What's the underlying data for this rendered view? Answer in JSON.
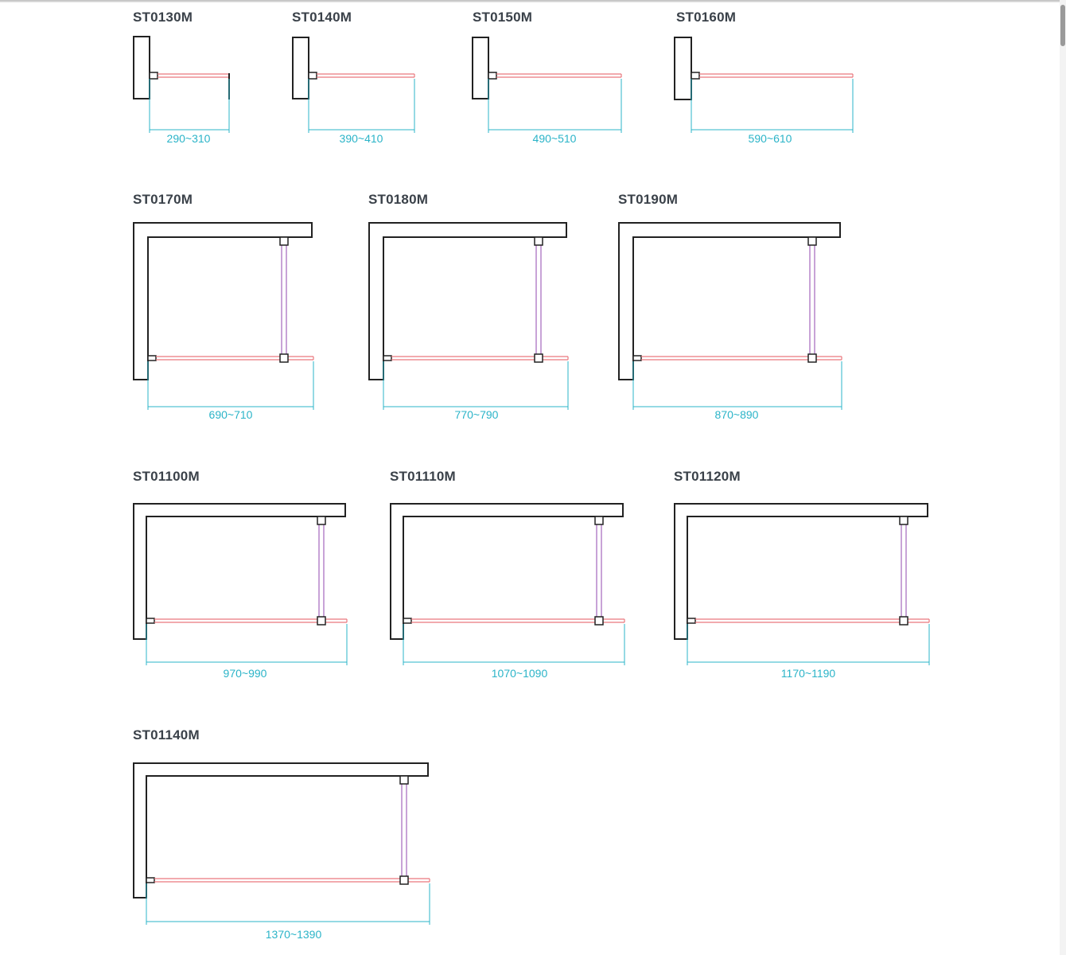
{
  "models": [
    {
      "name": "ST0130M",
      "dimension": "290~310",
      "type": "single-panel"
    },
    {
      "name": "ST0140M",
      "dimension": "390~410",
      "type": "single-panel"
    },
    {
      "name": "ST0150M",
      "dimension": "490~510",
      "type": "single-panel"
    },
    {
      "name": "ST0160M",
      "dimension": "590~610",
      "type": "single-panel"
    },
    {
      "name": "ST0170M",
      "dimension": "690~710",
      "type": "panel-with-support-bar"
    },
    {
      "name": "ST0180M",
      "dimension": "770~790",
      "type": "panel-with-support-bar"
    },
    {
      "name": "ST0190M",
      "dimension": "870~890",
      "type": "panel-with-support-bar"
    },
    {
      "name": "ST01100M",
      "dimension": "970~990",
      "type": "panel-with-support-bar"
    },
    {
      "name": "ST01110M",
      "dimension": "1070~1090",
      "type": "panel-with-support-bar"
    },
    {
      "name": "ST01120M",
      "dimension": "1170~1190",
      "type": "panel-with-support-bar"
    },
    {
      "name": "ST01140M",
      "dimension": "1370~1390",
      "type": "panel-with-support-bar"
    }
  ],
  "colors": {
    "title": "#3a4149",
    "outline": "#222222",
    "glass": "#e9777d",
    "support_bar": "#b07cc6",
    "dimension": "#2bb4c8"
  }
}
